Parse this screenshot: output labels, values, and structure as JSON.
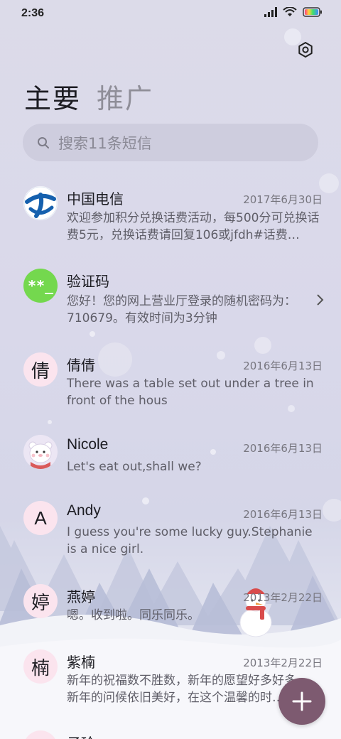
{
  "status_bar": {
    "time": "2:36"
  },
  "tabs": [
    {
      "label": "主要",
      "active": true
    },
    {
      "label": "推广",
      "active": false
    }
  ],
  "search": {
    "placeholder": "搜索11条短信"
  },
  "conversations": [
    {
      "name": "中国电信",
      "date": "2017年6月30日",
      "preview": "欢迎参加积分兑换话费活动，每500分可兑换话费5元，兑换话费请回复106或jfdh#话费…",
      "avatar_type": "china-telecom-logo-icon"
    },
    {
      "name": "验证码",
      "date": "",
      "preview": "您好！您的网上营业厅登录的随机密码为：710679。有效时间为3分钟",
      "avatar_type": "verification-code-icon",
      "avatar_text": "**_"
    },
    {
      "name": "倩倩",
      "date": "2016年6月13日",
      "preview": "There was a table set out under a tree in front of the hous",
      "avatar_letter": "倩"
    },
    {
      "name": "Nicole",
      "date": "2016年6月13日",
      "preview": "Let's eat out,shall we?",
      "avatar_type": "bear-avatar-icon"
    },
    {
      "name": "Andy",
      "date": "2016年6月13日",
      "preview": "I guess you're some lucky guy.Stephanie is a nice girl.",
      "avatar_letter": "A"
    },
    {
      "name": "燕婷",
      "date": "2013年2月22日",
      "preview": "嗯。收到啦。同乐同乐。",
      "avatar_letter": "婷"
    },
    {
      "name": "紫楠",
      "date": "2013年2月22日",
      "preview": "新年的祝福数不胜数，新年的愿望好多好多，新年的问候依旧美好，在这个温馨的时…",
      "avatar_letter": "楠"
    },
    {
      "name": "子玲",
      "date": "",
      "preview": "",
      "avatar_letter": ""
    }
  ],
  "colors": {
    "accent": "#7d5a70",
    "avatar_bg": "#fbe4ee",
    "verify_green": "#74d84e",
    "telecom_blue": "#1560ae"
  }
}
